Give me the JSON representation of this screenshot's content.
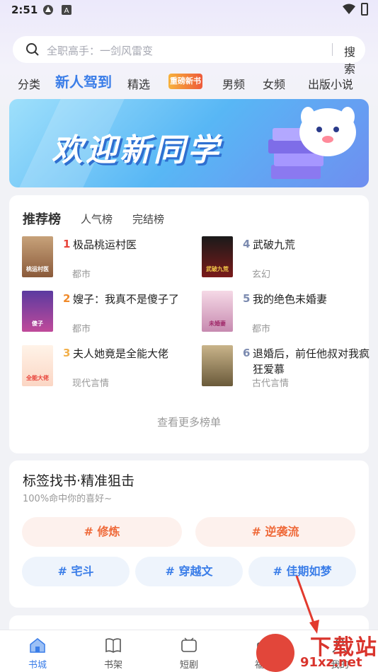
{
  "status": {
    "time": "2:51"
  },
  "search": {
    "placeholder": "全职高手：一剑风雷变",
    "button": "搜索"
  },
  "nav": {
    "items": [
      "分类",
      "新人驾到",
      "精选",
      "重磅新书",
      "男频",
      "女频",
      "出版小说"
    ]
  },
  "banner": {
    "title": "欢迎新同学"
  },
  "ranking": {
    "tabs": [
      "推荐榜",
      "人气榜",
      "完结榜"
    ],
    "books": [
      {
        "rank": "1",
        "title": "极品桃运村医",
        "category": "都市",
        "cover_text": "桃运村医"
      },
      {
        "rank": "2",
        "title": "嫂子：我真不是傻子了",
        "category": "都市",
        "cover_text": "傻子"
      },
      {
        "rank": "3",
        "title": "夫人她竟是全能大佬",
        "category": "现代言情",
        "cover_text": "全能大佬"
      },
      {
        "rank": "4",
        "title": "武破九荒",
        "category": "玄幻",
        "cover_text": "武破九荒"
      },
      {
        "rank": "5",
        "title": "我的绝色未婚妻",
        "category": "都市",
        "cover_text": "未婚妻"
      },
      {
        "rank": "6",
        "title": "退婚后，前任他叔对我疯狂爱慕",
        "category": "古代言情",
        "cover_text": ""
      }
    ],
    "more": "查看更多榜单"
  },
  "tags": {
    "title": "标签找书·精准狙击",
    "subtitle": "100%命中你的喜好~",
    "items": [
      "# 修炼",
      "# 逆袭流",
      "# 宅斗",
      "# 穿越文",
      "# 佳期如梦"
    ]
  },
  "tabbar": {
    "items": [
      "书城",
      "书架",
      "短剧",
      "福利",
      "我的"
    ]
  },
  "watermark": {
    "line1": "下载站",
    "line2": "91xz.net"
  },
  "colors": {
    "accent": "#3a7de8",
    "rank_top": "#e8453c",
    "tag_orange": "#ef6a3a"
  }
}
